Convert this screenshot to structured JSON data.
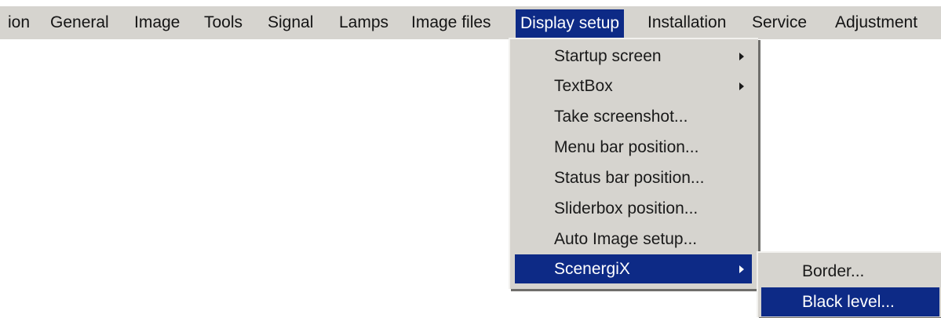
{
  "menubar": {
    "items": [
      {
        "label": "ion",
        "active": false
      },
      {
        "label": "General",
        "active": false
      },
      {
        "label": "Image",
        "active": false
      },
      {
        "label": "Tools",
        "active": false
      },
      {
        "label": "Signal",
        "active": false
      },
      {
        "label": "Lamps",
        "active": false
      },
      {
        "label": "Image files",
        "active": false
      },
      {
        "label": "Display setup",
        "active": true
      },
      {
        "label": "Installation",
        "active": false
      },
      {
        "label": "Service",
        "active": false
      },
      {
        "label": "Adjustment",
        "active": false
      }
    ]
  },
  "display_setup_menu": {
    "items": [
      {
        "label": "Startup screen",
        "has_submenu": true,
        "selected": false
      },
      {
        "label": "TextBox",
        "has_submenu": true,
        "selected": false
      },
      {
        "label": "Take screenshot...",
        "has_submenu": false,
        "selected": false
      },
      {
        "label": "Menu bar position...",
        "has_submenu": false,
        "selected": false
      },
      {
        "label": "Status bar position...",
        "has_submenu": false,
        "selected": false
      },
      {
        "label": "Sliderbox position...",
        "has_submenu": false,
        "selected": false
      },
      {
        "label": "Auto Image setup...",
        "has_submenu": false,
        "selected": false
      },
      {
        "label": "ScenergiX",
        "has_submenu": true,
        "selected": true
      }
    ]
  },
  "scenergix_submenu": {
    "items": [
      {
        "label": "Border...",
        "selected": false
      },
      {
        "label": "Black level...",
        "selected": true
      }
    ]
  },
  "colors": {
    "menu_background": "#d6d4cf",
    "highlight": "#0d2a86",
    "highlight_text": "#ffffff",
    "text": "#141414"
  }
}
